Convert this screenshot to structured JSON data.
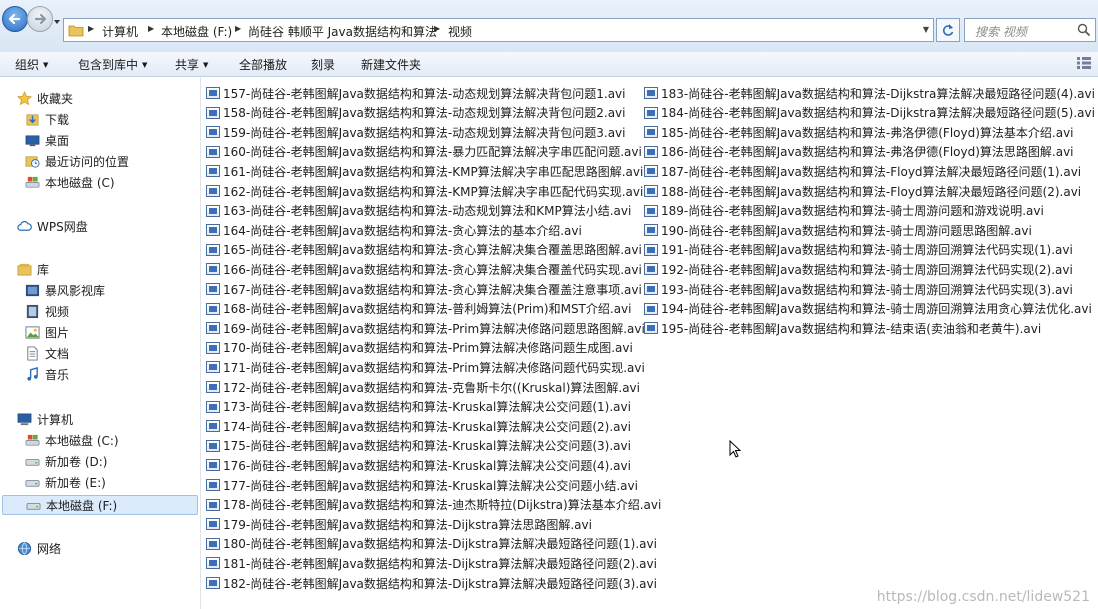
{
  "address": {
    "crumbs": [
      "计算机",
      "本地磁盘 (F:)",
      "尚硅谷 韩顺平 Java数据结构和算法",
      "视频"
    ]
  },
  "search": {
    "placeholder": "搜索 视频"
  },
  "toolbar": {
    "organize": "组织",
    "include_in_library": "包含到库中",
    "share": "共享",
    "play_all": "全部播放",
    "burn": "刻录",
    "new_folder": "新建文件夹"
  },
  "sidebar": {
    "favorites": {
      "label": "收藏夹",
      "items": [
        "下载",
        "桌面",
        "最近访问的位置",
        "本地磁盘 (C)"
      ]
    },
    "wps": {
      "label": "WPS网盘"
    },
    "libraries": {
      "label": "库",
      "items": [
        "暴风影视库",
        "视频",
        "图片",
        "文档",
        "音乐"
      ]
    },
    "computer": {
      "label": "计算机",
      "items": [
        "本地磁盘 (C:)",
        "新加卷 (D:)",
        "新加卷 (E:)",
        "本地磁盘 (F:)"
      ]
    },
    "network": {
      "label": "网络"
    }
  },
  "files": {
    "column1": [
      "157-尚硅谷-老韩图解Java数据结构和算法-动态规划算法解决背包问题1.avi",
      "158-尚硅谷-老韩图解Java数据结构和算法-动态规划算法解决背包问题2.avi",
      "159-尚硅谷-老韩图解Java数据结构和算法-动态规划算法解决背包问题3.avi",
      "160-尚硅谷-老韩图解Java数据结构和算法-暴力匹配算法解决字串匹配问题.avi",
      "161-尚硅谷-老韩图解Java数据结构和算法-KMP算法解决字串匹配思路图解.avi",
      "162-尚硅谷-老韩图解Java数据结构和算法-KMP算法解决字串匹配代码实现.avi",
      "163-尚硅谷-老韩图解Java数据结构和算法-动态规划算法和KMP算法小结.avi",
      "164-尚硅谷-老韩图解Java数据结构和算法-贪心算法的基本介绍.avi",
      "165-尚硅谷-老韩图解Java数据结构和算法-贪心算法解决集合覆盖思路图解.avi",
      "166-尚硅谷-老韩图解Java数据结构和算法-贪心算法解决集合覆盖代码实现.avi",
      "167-尚硅谷-老韩图解Java数据结构和算法-贪心算法解决集合覆盖注意事项.avi",
      "168-尚硅谷-老韩图解Java数据结构和算法-普利姆算法(Prim)和MST介绍.avi",
      "169-尚硅谷-老韩图解Java数据结构和算法-Prim算法解决修路问题思路图解.avi",
      "170-尚硅谷-老韩图解Java数据结构和算法-Prim算法解决修路问题生成图.avi",
      "171-尚硅谷-老韩图解Java数据结构和算法-Prim算法解决修路问题代码实现.avi",
      "172-尚硅谷-老韩图解Java数据结构和算法-克鲁斯卡尔((Kruskal)算法图解.avi",
      "173-尚硅谷-老韩图解Java数据结构和算法-Kruskal算法解决公交问题(1).avi",
      "174-尚硅谷-老韩图解Java数据结构和算法-Kruskal算法解决公交问题(2).avi",
      "175-尚硅谷-老韩图解Java数据结构和算法-Kruskal算法解决公交问题(3).avi",
      "176-尚硅谷-老韩图解Java数据结构和算法-Kruskal算法解决公交问题(4).avi",
      "177-尚硅谷-老韩图解Java数据结构和算法-Kruskal算法解决公交问题小结.avi",
      "178-尚硅谷-老韩图解Java数据结构和算法-迪杰斯特拉(Dijkstra)算法基本介绍.avi",
      "179-尚硅谷-老韩图解Java数据结构和算法-Dijkstra算法思路图解.avi",
      "180-尚硅谷-老韩图解Java数据结构和算法-Dijkstra算法解决最短路径问题(1).avi",
      "181-尚硅谷-老韩图解Java数据结构和算法-Dijkstra算法解决最短路径问题(2).avi",
      "182-尚硅谷-老韩图解Java数据结构和算法-Dijkstra算法解决最短路径问题(3).avi"
    ],
    "column2": [
      "183-尚硅谷-老韩图解Java数据结构和算法-Dijkstra算法解决最短路径问题(4).avi",
      "184-尚硅谷-老韩图解Java数据结构和算法-Dijkstra算法解决最短路径问题(5).avi",
      "185-尚硅谷-老韩图解Java数据结构和算法-弗洛伊德(Floyd)算法基本介绍.avi",
      "186-尚硅谷-老韩图解Java数据结构和算法-弗洛伊德(Floyd)算法思路图解.avi",
      "187-尚硅谷-老韩图解Java数据结构和算法-Floyd算法解决最短路径问题(1).avi",
      "188-尚硅谷-老韩图解Java数据结构和算法-Floyd算法解决最短路径问题(2).avi",
      "189-尚硅谷-老韩图解Java数据结构和算法-骑士周游问题和游戏说明.avi",
      "190-尚硅谷-老韩图解Java数据结构和算法-骑士周游问题思路图解.avi",
      "191-尚硅谷-老韩图解Java数据结构和算法-骑士周游回溯算法代码实现(1).avi",
      "192-尚硅谷-老韩图解Java数据结构和算法-骑士周游回溯算法代码实现(2).avi",
      "193-尚硅谷-老韩图解Java数据结构和算法-骑士周游回溯算法代码实现(3).avi",
      "194-尚硅谷-老韩图解Java数据结构和算法-骑士周游回溯算法用贪心算法优化.avi",
      "195-尚硅谷-老韩图解Java数据结构和算法-结束语(卖油翁和老黄牛).avi"
    ]
  },
  "watermark": "https://blog.csdn.net/lidew521"
}
